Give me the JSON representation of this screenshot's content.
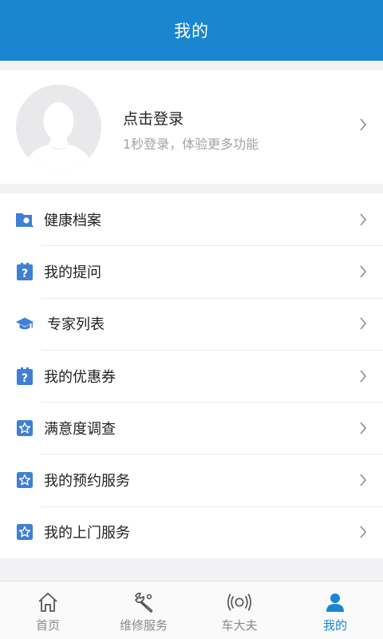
{
  "header": {
    "title": "我的"
  },
  "profile": {
    "title": "点击登录",
    "subtitle": "1秒登录，体验更多功能"
  },
  "menu": {
    "items": [
      {
        "label": "健康档案",
        "icon": "health-record-icon"
      },
      {
        "label": "我的提问",
        "icon": "question-icon"
      },
      {
        "label": "专家列表",
        "icon": "graduation-cap-icon"
      },
      {
        "label": "我的优惠券",
        "icon": "question-icon"
      },
      {
        "label": "满意度调查",
        "icon": "star-icon"
      },
      {
        "label": "我的预约服务",
        "icon": "star-icon"
      },
      {
        "label": "我的上门服务",
        "icon": "star-icon"
      }
    ]
  },
  "tabs": [
    {
      "label": "首页",
      "icon": "home-icon"
    },
    {
      "label": "维修服务",
      "icon": "wrench-icon"
    },
    {
      "label": "车大夫",
      "icon": "signal-icon"
    },
    {
      "label": "我的",
      "icon": "user-icon",
      "active": true
    }
  ],
  "colors": {
    "accent": "#1a86d0",
    "icon_blue": "#3f7fd6",
    "background": "#f2f2f4"
  }
}
